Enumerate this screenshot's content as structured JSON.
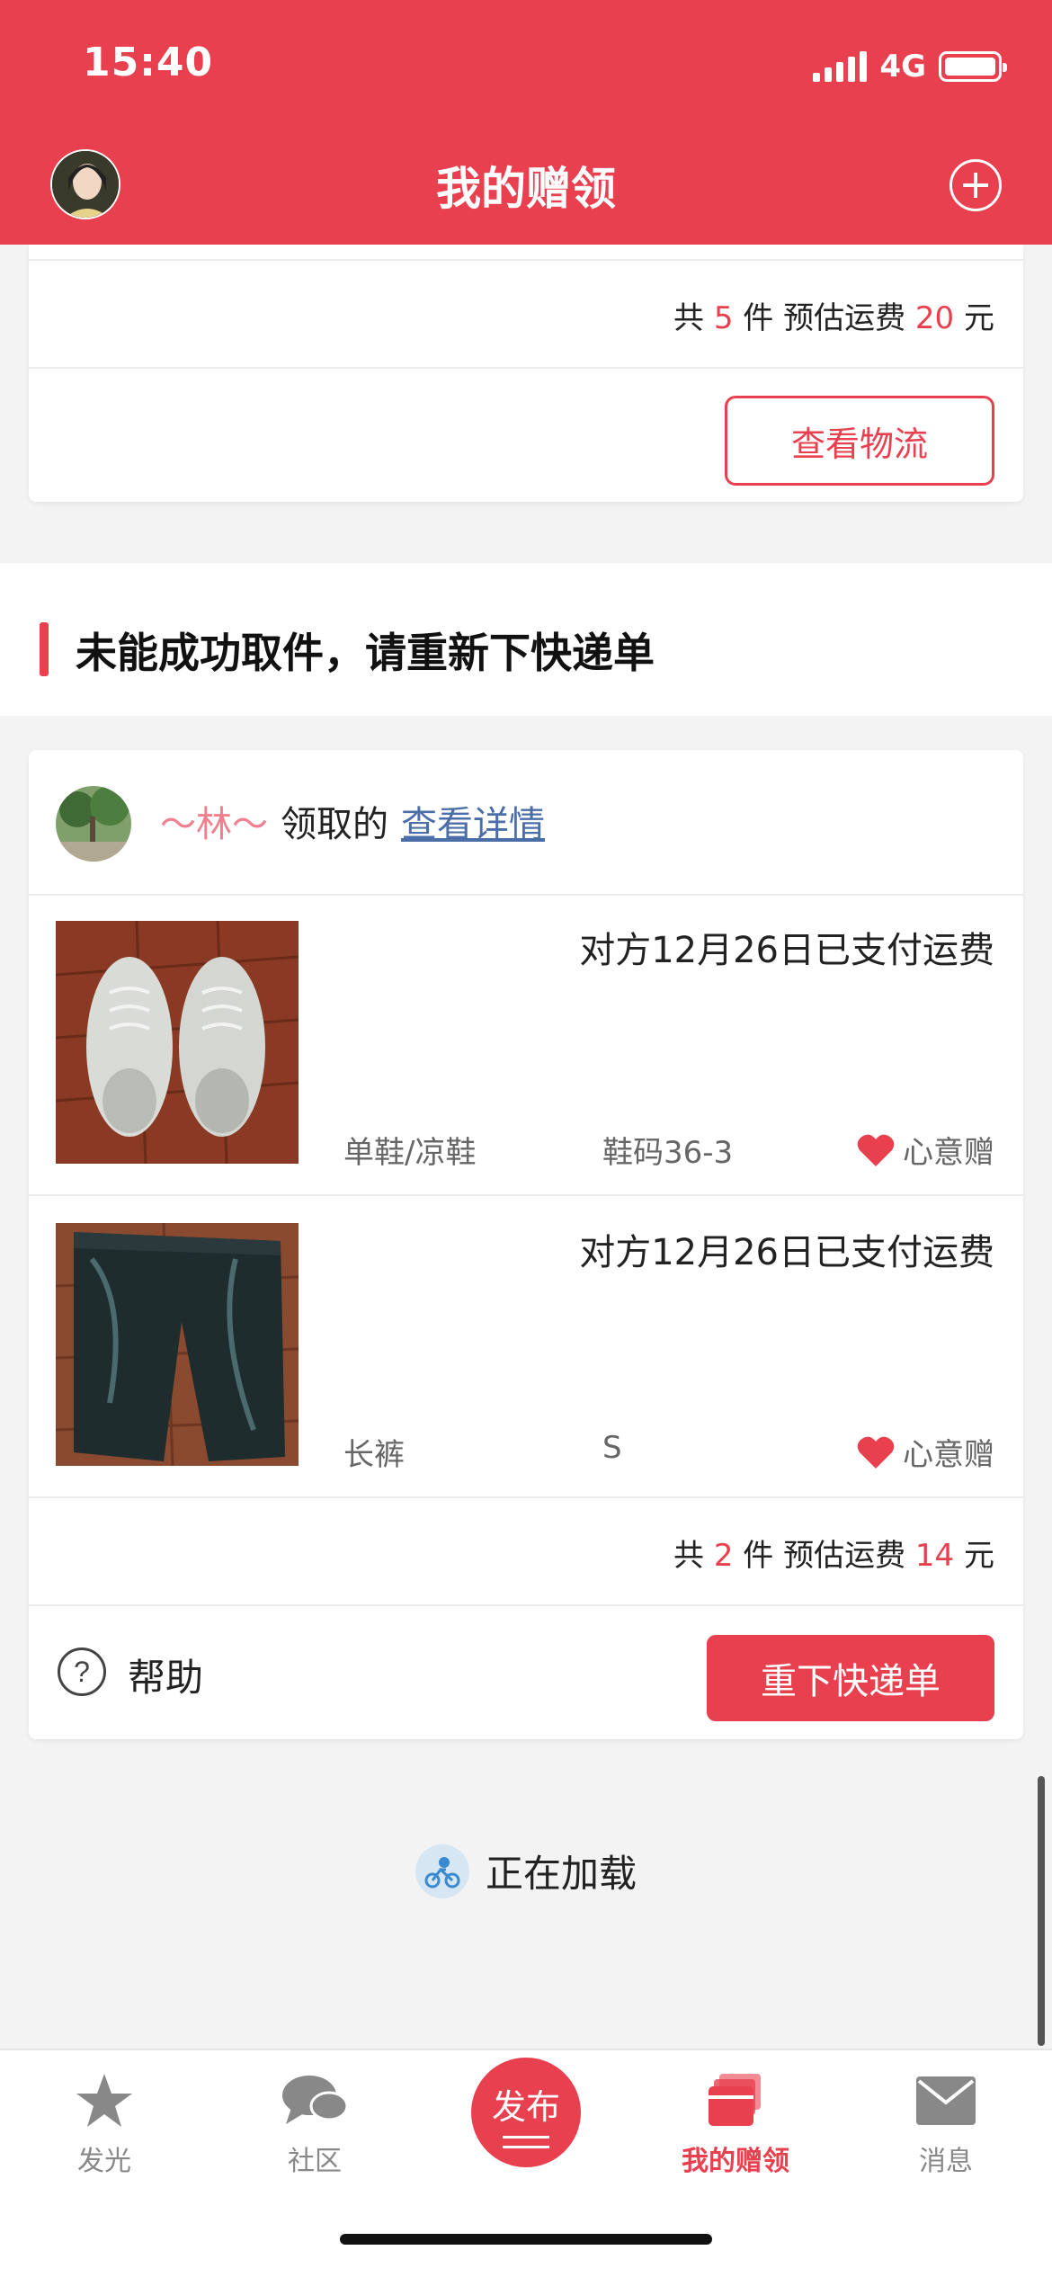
{
  "status_bar": {
    "time": "15:40",
    "network": "4G"
  },
  "header": {
    "title": "我的赠领"
  },
  "top_card": {
    "summary": {
      "prefix": "共",
      "count": "5",
      "mid": "件 预估运费",
      "fee": "20",
      "suffix": "元"
    },
    "logistics_button": "查看物流"
  },
  "section": {
    "title": "未能成功取件，请重新下快递单"
  },
  "claim_card": {
    "claimer": "～林～",
    "verb": "领取的",
    "detail_link": "查看详情",
    "items": [
      {
        "status": "对方12月26日已支付运费",
        "category": "单鞋/凉鞋",
        "size": "鞋码36-3",
        "tag": "心意赠"
      },
      {
        "status": "对方12月26日已支付运费",
        "category": "长裤",
        "size": "S",
        "tag": "心意赠"
      }
    ],
    "summary": {
      "prefix": "共",
      "count": "2",
      "mid": "件 预估运费",
      "fee": "14",
      "suffix": "元"
    },
    "help_label": "帮助",
    "reorder_button": "重下快递单"
  },
  "loading": {
    "text": "正在加载"
  },
  "tabbar": {
    "tabs": [
      {
        "label": "发光",
        "icon": "star-icon"
      },
      {
        "label": "社区",
        "icon": "chat-bubble-icon"
      },
      {
        "label": "发布",
        "icon": "publish-icon"
      },
      {
        "label": "我的赠领",
        "icon": "gift-box-icon",
        "active": true
      },
      {
        "label": "消息",
        "icon": "envelope-icon"
      }
    ]
  },
  "colors": {
    "brand": "#e8404f",
    "link": "#4b6ea8",
    "claimer": "#f08090"
  }
}
